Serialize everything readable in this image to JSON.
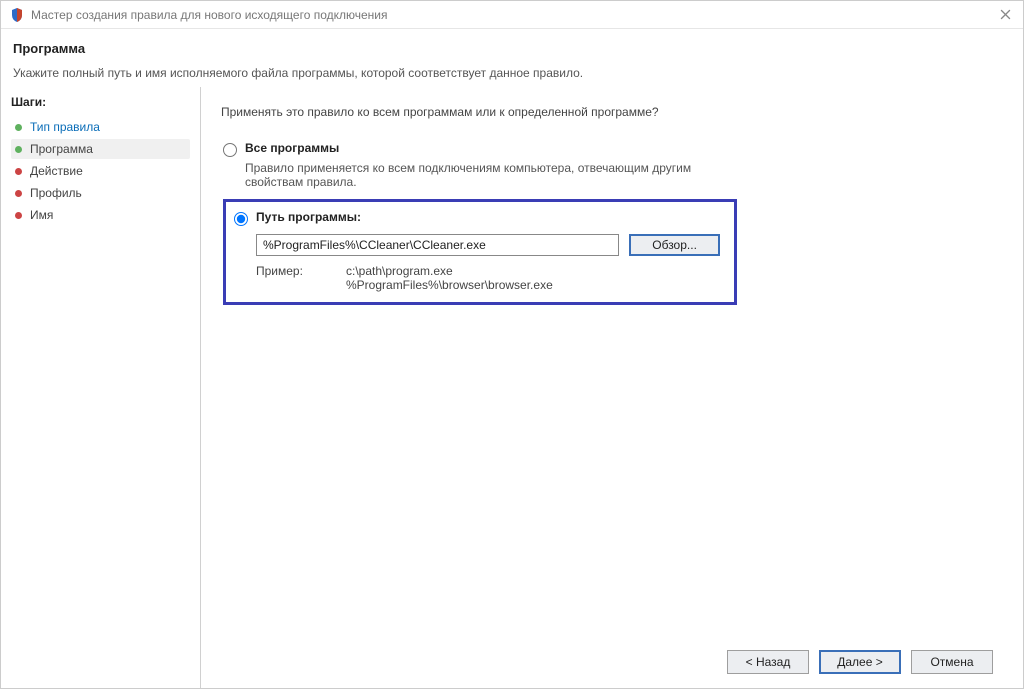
{
  "window": {
    "title": "Мастер создания правила для нового исходящего подключения"
  },
  "header": {
    "title": "Программа",
    "subtitle": "Укажите полный путь и имя исполняемого файла программы, которой соответствует данное правило."
  },
  "sidebar": {
    "title": "Шаги:",
    "steps": [
      {
        "label": "Тип правила"
      },
      {
        "label": "Программа"
      },
      {
        "label": "Действие"
      },
      {
        "label": "Профиль"
      },
      {
        "label": "Имя"
      }
    ]
  },
  "content": {
    "question": "Применять это правило ко всем программам или к определенной программе?",
    "all_programs": {
      "label": "Все программы",
      "desc": "Правило применяется ко всем подключениям компьютера, отвечающим другим свойствам правила."
    },
    "program_path": {
      "label": "Путь программы:",
      "value": "%ProgramFiles%\\CCleaner\\CCleaner.exe",
      "browse": "Обзор...",
      "example_label": "Пример:",
      "example_values": "c:\\path\\program.exe\n%ProgramFiles%\\browser\\browser.exe"
    }
  },
  "footer": {
    "back": "< Назад",
    "next": "Далее >",
    "cancel": "Отмена"
  }
}
